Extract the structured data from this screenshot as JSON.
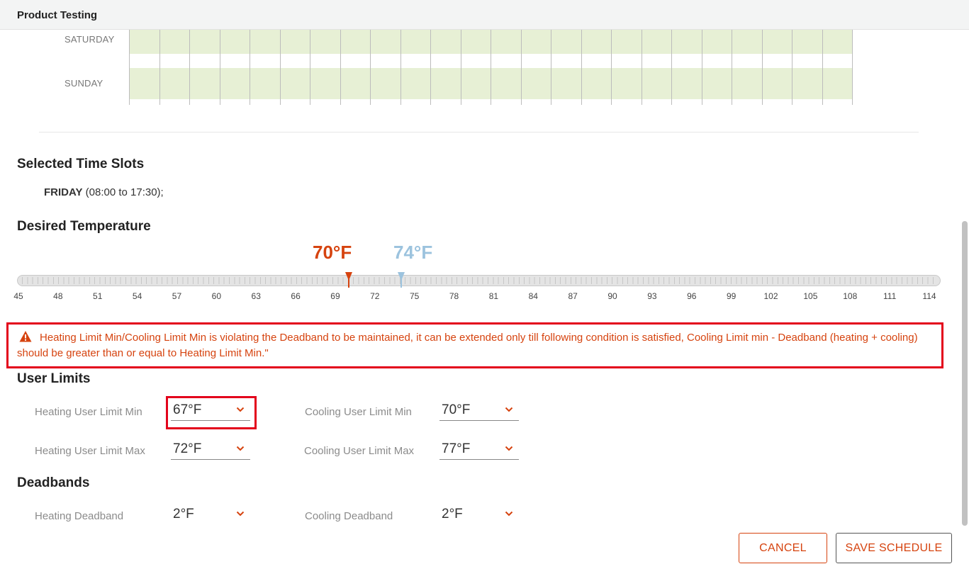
{
  "header": {
    "title": "Product Testing"
  },
  "schedule": {
    "days": [
      "SATURDAY",
      "SUNDAY"
    ]
  },
  "selected_slots": {
    "title": "Selected Time Slots",
    "day": "FRIDAY",
    "range": " (08:00 to 17:30);"
  },
  "desired_temperature": {
    "title": "Desired Temperature",
    "heat_setpoint": "70°F",
    "cool_setpoint": "74°F",
    "heat_value": 70,
    "cool_value": 74,
    "min": 45,
    "max": 114,
    "tick_labels": [
      "45",
      "48",
      "51",
      "54",
      "57",
      "60",
      "63",
      "66",
      "69",
      "72",
      "75",
      "78",
      "81",
      "84",
      "87",
      "90",
      "93",
      "96",
      "99",
      "102",
      "105",
      "108",
      "111",
      "114"
    ],
    "heat_color": "#d6430f",
    "cool_color": "#9cc3de"
  },
  "error": {
    "icon": "warning-icon",
    "message": "Heating Limit Min/Cooling Limit Min is violating the Deadband to be maintained, it can be extended only till following condition is satisfied, Cooling Limit min - Deadband (heating + cooling) should be greater than or equal to Heating Limit Min.\""
  },
  "user_limits": {
    "title": "User Limits",
    "heating_min_label": "Heating User Limit Min",
    "heating_min_value": "67°F",
    "heating_max_label": "Heating User Limit Max",
    "heating_max_value": "72°F",
    "cooling_min_label": "Cooling User Limit Min",
    "cooling_min_value": "70°F",
    "cooling_max_label": "Cooling User Limit Max",
    "cooling_max_value": "77°F"
  },
  "deadbands": {
    "title": "Deadbands",
    "heating_label": "Heating Deadband",
    "heating_value": "2°F",
    "cooling_label": "Cooling Deadband",
    "cooling_value": "2°F"
  },
  "actions": {
    "cancel": "CANCEL",
    "save": "SAVE SCHEDULE"
  },
  "colors": {
    "accent": "#d6430f",
    "error_border": "#e3001b",
    "schedule_fill": "#e7f0d5"
  }
}
